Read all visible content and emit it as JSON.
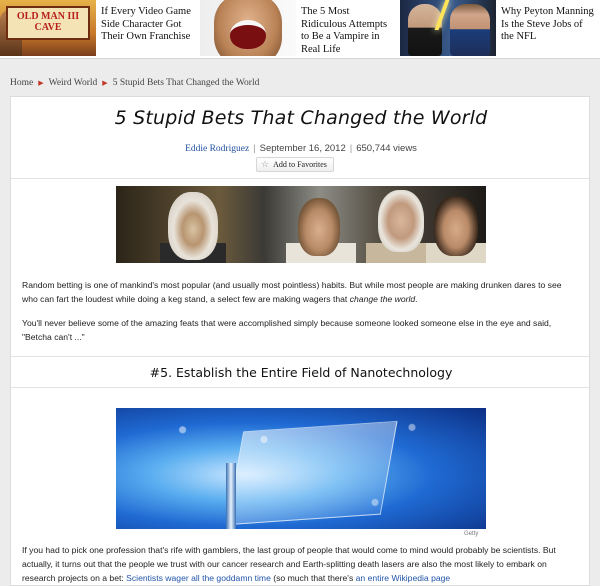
{
  "promos": [
    {
      "sign_text": "OLD MAN III CAVE",
      "text": "If Every Video Game Side Character Got Their Own Franchise"
    },
    {
      "text": "The 5 Most Ridiculous Attempts to Be a Vampire in Real Life"
    },
    {
      "text": "Why Peyton Manning Is the Steve Jobs of the NFL"
    }
  ],
  "breadcrumb": [
    "Home",
    "Weird World",
    "5 Stupid Bets That Changed the World"
  ],
  "article": {
    "title": "5 Stupid Bets That Changed the World",
    "author": "Eddie Rodriguez",
    "date": "September 16, 2012",
    "views": "650,744 views",
    "favorite_label": "Add to Favorites",
    "intro_p1_a": "Random betting is one of mankind's most popular (and usually most pointless) habits. But while most people are making drunken dares to see who can fart the loudest while doing a keg stand, a select few are making wagers that ",
    "intro_p1_em": "change the world",
    "intro_p1_b": ".",
    "intro_p2": "You'll never believe some of the amazing feats that were accomplished simply because someone looked someone else in the eye and said, \"Betcha can't ...\"",
    "section_title": "#5. Establish the Entire Field of Nanotechnology",
    "image_credit": "Getty",
    "body_p1_a": "If you had to pick one profession that's rife with gamblers, the last group of people that would come to mind would probably be scientists. But actually, it turns out that the people we trust with our cancer research and Earth-splitting death lasers are also the most likely to embark on research projects on a bet: ",
    "body_link1": "Scientists wager all the goddamn time",
    "body_p1_b": " (so much that there's ",
    "body_link2": "an entire Wikipedia page"
  }
}
